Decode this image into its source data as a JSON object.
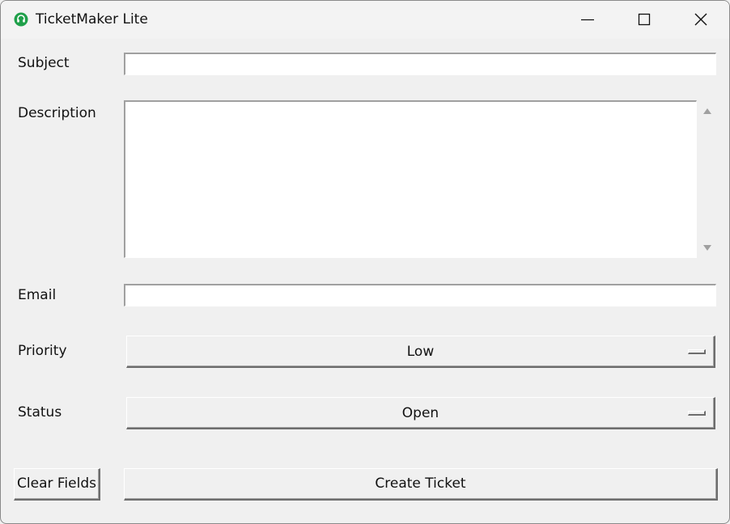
{
  "window": {
    "title": "TicketMaker Lite",
    "icon": "headset-icon",
    "controls": {
      "minimize": "minimize-icon",
      "maximize": "maximize-icon",
      "close": "close-icon"
    }
  },
  "form": {
    "subject": {
      "label": "Subject",
      "value": ""
    },
    "description": {
      "label": "Description",
      "value": ""
    },
    "email": {
      "label": "Email",
      "value": ""
    },
    "priority": {
      "label": "Priority",
      "selected": "Low"
    },
    "status": {
      "label": "Status",
      "selected": "Open"
    }
  },
  "actions": {
    "clear_label": "Clear Fields",
    "create_label": "Create Ticket"
  },
  "colors": {
    "icon_green": "#1fa04a",
    "background": "#f0f0f0"
  }
}
